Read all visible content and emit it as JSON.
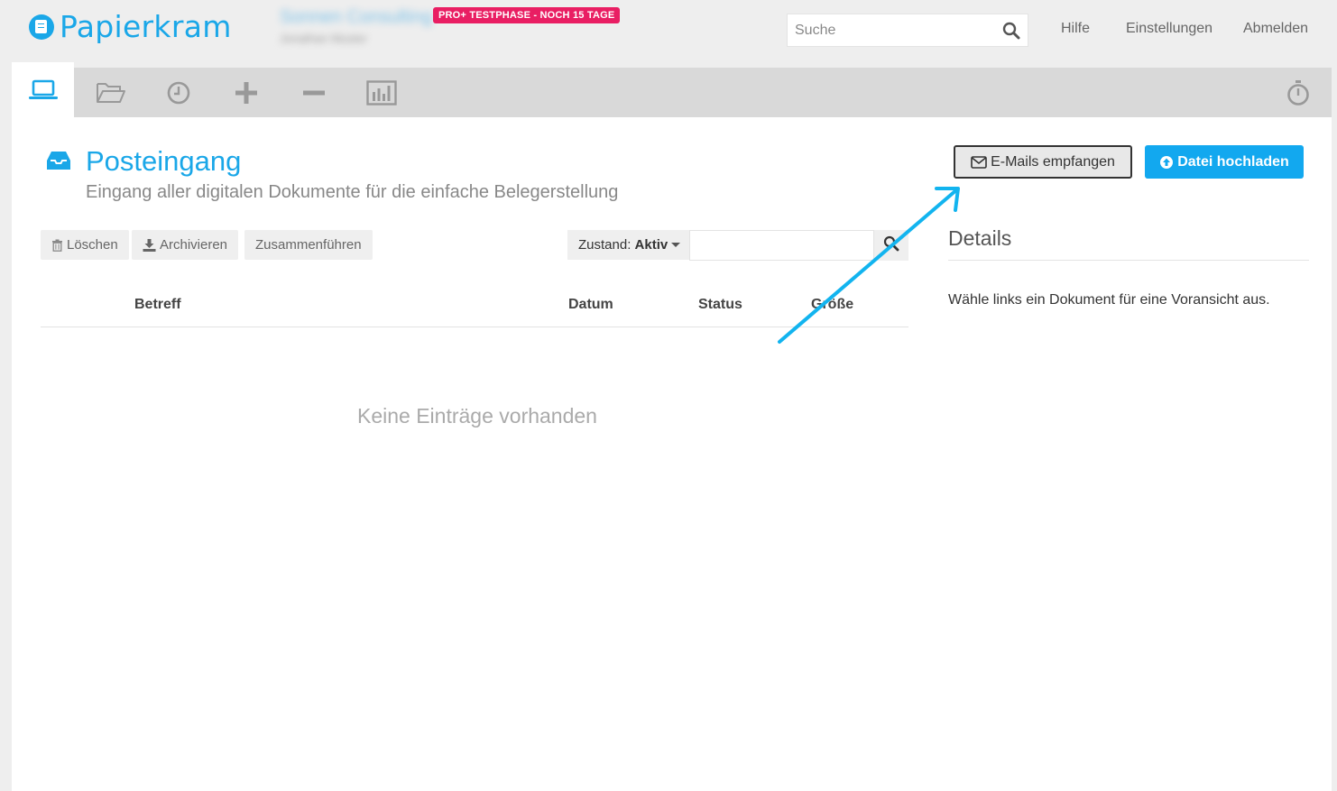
{
  "header": {
    "logo_text": "Papierkram",
    "company_name": "Sonnen Consulting",
    "company_user": "Jonathan Muster",
    "trial_badge": "PRO+ TESTPHASE - NOCH 15 TAGE",
    "search": {
      "placeholder": "Suche",
      "icon": "search-icon"
    },
    "links": {
      "help": "Hilfe",
      "settings": "Einstellungen",
      "logout": "Abmelden"
    }
  },
  "tabbar": {
    "tabs": [
      {
        "icon": "laptop-icon",
        "active": true
      },
      {
        "icon": "folder-open-icon",
        "active": false
      },
      {
        "icon": "clock-icon",
        "active": false
      },
      {
        "icon": "plus-icon",
        "active": false
      },
      {
        "icon": "minus-icon",
        "active": false
      },
      {
        "icon": "bar-chart-icon",
        "active": false
      }
    ],
    "right_icon": "stopwatch-icon"
  },
  "page": {
    "title": "Posteingang",
    "subtitle": "Eingang aller digitalen Dokumente für die einfache Belegerstellung",
    "title_icon": "inbox-icon",
    "buttons": {
      "receive_mail": "E-Mails empfangen",
      "upload": "Datei hochladen"
    }
  },
  "actions": {
    "delete": "Löschen",
    "archive": "Archivieren",
    "merge": "Zusammenführen"
  },
  "filter": {
    "label": "Zustand:",
    "value": "Aktiv",
    "input_value": ""
  },
  "table": {
    "columns": {
      "subject": "Betreff",
      "date": "Datum",
      "status": "Status",
      "size": "Größe"
    },
    "rows": [],
    "empty_text": "Keine Einträge vorhanden"
  },
  "details": {
    "title": "Details",
    "hint": "Wähle links ein Dokument für eine Voransicht aus."
  },
  "colors": {
    "accent": "#1aa7e8",
    "upload_button": "#12a8ef",
    "badge": "#e91e63",
    "annotation_arrow": "#12b4ef"
  }
}
